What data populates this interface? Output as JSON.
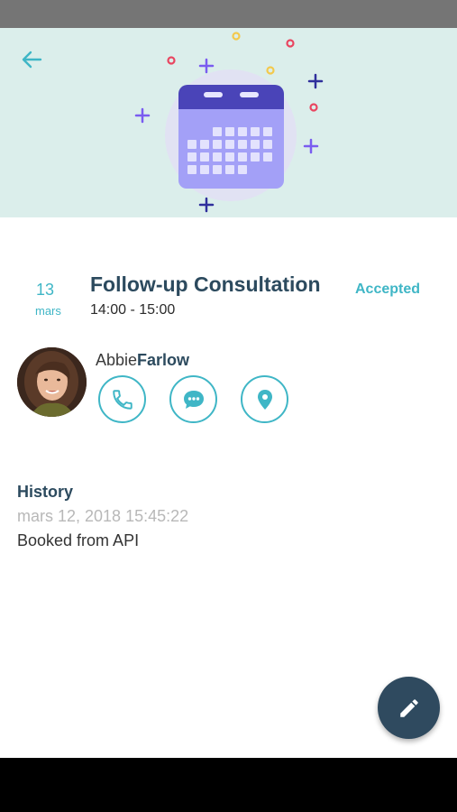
{
  "appointment": {
    "day": "13",
    "month": "mars",
    "title": "Follow-up Consultation",
    "time": "14:00 - 15:00",
    "status": "Accepted"
  },
  "patient": {
    "first_name": "Abbie",
    "last_name": "Farlow"
  },
  "history": {
    "title": "History",
    "entries": [
      {
        "date": "mars 12, 2018 15:45:22",
        "text": "Booked from API"
      }
    ]
  },
  "icons": {
    "back": "arrow-left-icon",
    "call": "phone-icon",
    "message": "chat-bubble-icon",
    "location": "map-pin-icon",
    "edit": "pencil-icon",
    "hero": "calendar-illustration"
  },
  "colors": {
    "accent": "#3fb6c6",
    "primary_dark": "#2f4a5f",
    "hero_bg": "#dbeeeb",
    "calendar": "#a3a0f7",
    "calendar_header": "#4a44b8"
  }
}
